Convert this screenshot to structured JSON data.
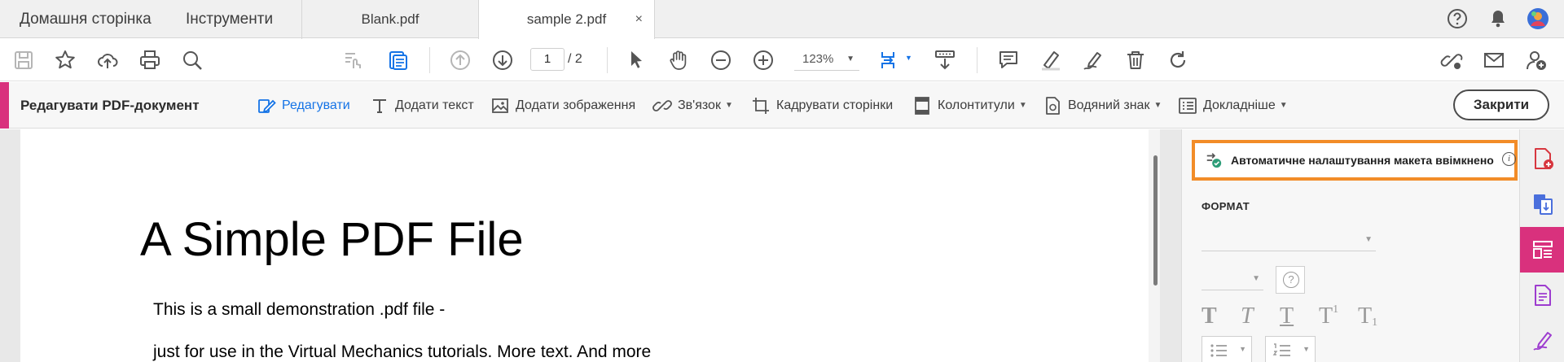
{
  "nav": {
    "home": "Домашня сторінка",
    "tools": "Інструменти"
  },
  "tabs": [
    {
      "label": "Blank.pdf"
    },
    {
      "label": "sample 2.pdf",
      "close": "×"
    }
  ],
  "toolbar": {
    "page_current": "1",
    "page_total": "/ 2",
    "zoom": "123%"
  },
  "edit_toolbar": {
    "title": "Редагувати PDF-документ",
    "tools": {
      "edit": "Редагувати",
      "add_text": "Додати текст",
      "add_image": "Додати зображення",
      "link": "Зв'язок",
      "crop": "Кадрувати сторінки",
      "header_footer": "Колонтитули",
      "watermark": "Водяний знак",
      "more": "Докладніше"
    },
    "close": "Закрити"
  },
  "document": {
    "title": "A Simple PDF File",
    "line1": "This is a small demonstration .pdf file -",
    "line2": "just for use in the Virtual Mechanics tutorials. More text. And more"
  },
  "right_panel": {
    "auto_layout": "Автоматичне налаштування макета ввімкнено",
    "format_label": "ФОРМАТ",
    "help_glyph": "?",
    "info_glyph": "i"
  },
  "colors": {
    "accent_pink": "#d9317d",
    "highlight_orange": "#f28c28",
    "active_blue": "#1473e6"
  }
}
